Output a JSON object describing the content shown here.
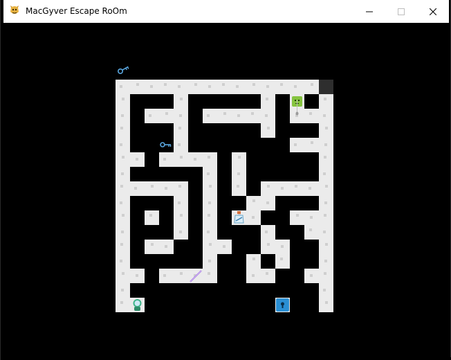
{
  "window": {
    "title": "MacGyver Escape RoOm",
    "app_icon": "python-pygame-icon",
    "controls": {
      "minimize_icon": "minimize-icon",
      "maximize_icon": "maximize-icon",
      "close_icon": "close-icon"
    }
  },
  "game": {
    "grid_rows": [
      "XXXXXXXXXXXXXXE",
      "X...X.....X.G.X",
      "X.XXX.XXXXX.WXX",
      "X...X.....X...X",
      "X...X.......XXX",
      "XX.XXXX.X.....X",
      "X.....X.X.....X",
      "XXXXX.X.X.XXXXX",
      "X...X.X..XX...X",
      "X.X.X.X.XX..XXX",
      "X...X.X...X..XX",
      "X.XX..XX..XX..X",
      "X.....X..X.X..X",
      "XX.XXXX..XX..XX",
      "X.............X",
      "XP.........D..X"
    ],
    "legend": {
      "X": "path-tile",
      ".": "wall-void",
      "P": "player-start",
      "G": "guardian",
      "E": "exit",
      "D": "locked-door",
      "W": "needle"
    },
    "colors": {
      "background": "#000000",
      "path_tile": "#ebebeb",
      "path_speckle": "#cfcfcf",
      "exit": "#2e2e2e",
      "guardian": "#86c440",
      "door": "#2a8fd4",
      "key": "#5aa7e0",
      "wand": "#a070e0"
    },
    "items": [
      {
        "name": "key",
        "icon": "key-icon",
        "row": 4,
        "col": 3
      },
      {
        "name": "potion",
        "icon": "potion-bottle-icon",
        "row": 9,
        "col": 8
      },
      {
        "name": "wand",
        "icon": "wand-icon",
        "row": 13,
        "col": 5
      }
    ],
    "inventory_icon": "key-icon"
  }
}
